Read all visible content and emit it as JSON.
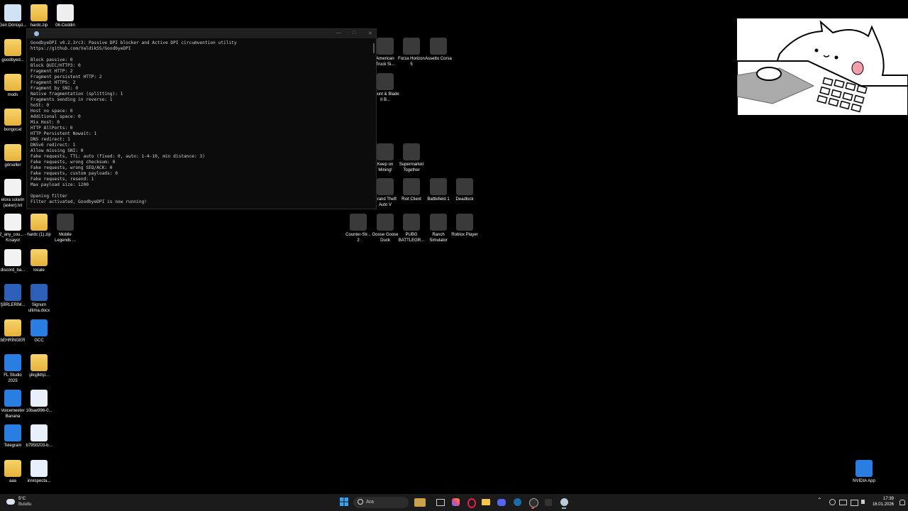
{
  "desktop": {
    "icons": [
      {
        "label": "Geri Dönüşü...",
        "type": "bin"
      },
      {
        "label": "hardc.zip",
        "type": "folder"
      },
      {
        "label": "06-Ceddin Deden...",
        "type": "media"
      },
      {
        "label": "goodbyed...",
        "type": "folder"
      },
      {
        "label": "mods",
        "type": "folder"
      },
      {
        "label": "bongocat",
        "type": "folder"
      },
      {
        "label": "görseller",
        "type": "folder"
      },
      {
        "label": "elora solarin (asker).txt",
        "type": "file"
      },
      {
        "label": "2_any_cou... - Kısayol",
        "type": "file"
      },
      {
        "label": "hardc (1).zip",
        "type": "folder"
      },
      {
        "label": "Mobile Legends ...",
        "type": "game"
      },
      {
        "label": "discord_ba...",
        "type": "file"
      },
      {
        "label": "locale",
        "type": "folder"
      },
      {
        "label": "ŞİİRLERİM...",
        "type": "word"
      },
      {
        "label": "Signum ultima.docx",
        "type": "word"
      },
      {
        "label": "bEHRİNGER",
        "type": "folder"
      },
      {
        "label": "GCC",
        "type": "app"
      },
      {
        "label": "FL Studio 2025",
        "type": "app"
      },
      {
        "label": "şlkşjlkllşl...",
        "type": "folder"
      },
      {
        "label": "Voicemeeter Banana",
        "type": "app"
      },
      {
        "label": "10bae996-0...",
        "type": "image"
      },
      {
        "label": "Telegram",
        "type": "app"
      },
      {
        "label": "b7950203-b...",
        "type": "image"
      },
      {
        "label": "aaa",
        "type": "folder"
      },
      {
        "label": "inrespecta...",
        "type": "image"
      },
      {
        "label": "American Truck Si...",
        "type": "game"
      },
      {
        "label": "Forza Horizon 5",
        "type": "game"
      },
      {
        "label": "Assetto Corsa",
        "type": "game"
      },
      {
        "label": "Mount & Blade II B...",
        "type": "game"
      },
      {
        "label": "Keep on Mining!",
        "type": "game"
      },
      {
        "label": "Supermarket Together",
        "type": "game"
      },
      {
        "label": "Grand Theft Auto V",
        "type": "game"
      },
      {
        "label": "Riot Client",
        "type": "game"
      },
      {
        "label": "Battlefield 1",
        "type": "game"
      },
      {
        "label": "Deadlock",
        "type": "game"
      },
      {
        "label": "Counter-Str... 2",
        "type": "game"
      },
      {
        "label": "Goose Goose Duck",
        "type": "game"
      },
      {
        "label": "PUBG BATTLEGR...",
        "type": "game"
      },
      {
        "label": "Ranch Simulator",
        "type": "game"
      },
      {
        "label": "Roblox Player",
        "type": "game"
      },
      {
        "label": "NVIDIA App",
        "type": "app"
      }
    ]
  },
  "console": {
    "lines": [
      "GoodbyeDPI v0.2.3rc3: Passive DPI blocker and Active DPI circumvention utility",
      "https://github.com/ValdikSS/GoodbyeDPI",
      "",
      "Block passive: 0",
      "Block QUIC/HTTP3: 0",
      "Fragment HTTP: 2",
      "Fragment persistent HTTP: 2",
      "Fragment HTTPS: 2",
      "Fragment by SNI: 0",
      "Native fragmentation (splitting): 1",
      "Fragments sending in reverse: 1",
      "hoSt: 0",
      "Host no space: 0",
      "Additional space: 0",
      "Mix Host: 0",
      "HTTP AllPorts: 0",
      "HTTP Persistent Nowait: 1",
      "DNS redirect: 1",
      "DNSv6 redirect: 1",
      "Allow missing SNI: 0",
      "Fake requests, TTL: auto (fixed: 0, auto: 1-4-10, min distance: 3)",
      "Fake requests, wrong checksum: 0",
      "Fake requests, wrong SEQ/ACK: 0",
      "Fake requests, custom payloads: 0",
      "Fake requests, resend: 1",
      "Max payload size: 1200",
      "",
      "Opening filter",
      "Filter activated, GoodbyeDPI is now running!"
    ]
  },
  "taskbar": {
    "weather_temp": "5°C",
    "weather_desc": "Bulutlu",
    "search_placeholder": "Ara",
    "time": "17:39",
    "date": "16.01.2026"
  }
}
